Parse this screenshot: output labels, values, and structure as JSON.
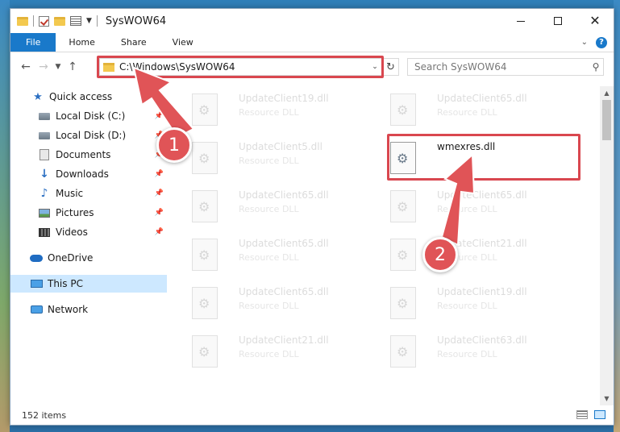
{
  "window": {
    "title": "SysWOW64",
    "controls": {
      "minimize": "minimize",
      "maximize": "maximize",
      "close": "✕"
    }
  },
  "ribbon": {
    "tabs": [
      {
        "label": "File",
        "active": true
      },
      {
        "label": "Home"
      },
      {
        "label": "Share"
      },
      {
        "label": "View"
      }
    ]
  },
  "address": {
    "path": "C:\\Windows\\SysWOW64"
  },
  "search": {
    "placeholder": "Search SysWOW64"
  },
  "sidebar": {
    "items": [
      {
        "label": "Quick access",
        "icon": "star-icon"
      },
      {
        "label": "Local Disk (C:)",
        "icon": "disk-icon",
        "pinned": true
      },
      {
        "label": "Local Disk (D:)",
        "icon": "disk-icon",
        "pinned": true
      },
      {
        "label": "Documents",
        "icon": "documents-icon",
        "pinned": true
      },
      {
        "label": "Downloads",
        "icon": "download-icon",
        "pinned": true
      },
      {
        "label": "Music",
        "icon": "music-icon",
        "pinned": true
      },
      {
        "label": "Pictures",
        "icon": "pictures-icon",
        "pinned": true
      },
      {
        "label": "Videos",
        "icon": "videos-icon",
        "pinned": true
      },
      {
        "label": "OneDrive",
        "icon": "cloud-icon"
      },
      {
        "label": "This PC",
        "icon": "pc-icon",
        "selected": true
      },
      {
        "label": "Network",
        "icon": "network-icon"
      }
    ]
  },
  "files": {
    "left": [
      {
        "name": "UpdateClient19.dll",
        "type": "Resource DLL"
      },
      {
        "name": "UpdateClient5.dll",
        "type": "Resource DLL"
      },
      {
        "name": "UpdateClient65.dll",
        "type": "Resource DLL"
      },
      {
        "name": "UpdateClient65.dll",
        "type": "Resource DLL"
      },
      {
        "name": "UpdateClient65.dll",
        "type": "Resource DLL"
      },
      {
        "name": "UpdateClient21.dll",
        "type": "Resource DLL"
      }
    ],
    "right": [
      {
        "name": "UpdateClient65.dll",
        "type": "Resource DLL"
      },
      {
        "name": "wmexres.dll",
        "type": "",
        "highlighted": true
      },
      {
        "name": "UpdateClient65.dll",
        "type": "Resource DLL"
      },
      {
        "name": "UpdateClient21.dll",
        "type": "Resource DLL"
      },
      {
        "name": "UpdateClient19.dll",
        "type": "Resource DLL"
      },
      {
        "name": "UpdateClient63.dll",
        "type": "Resource DLL"
      }
    ]
  },
  "status": {
    "item_count": "152 items"
  },
  "annotations": {
    "step1": "1",
    "step2": "2",
    "color": "#e05457"
  }
}
